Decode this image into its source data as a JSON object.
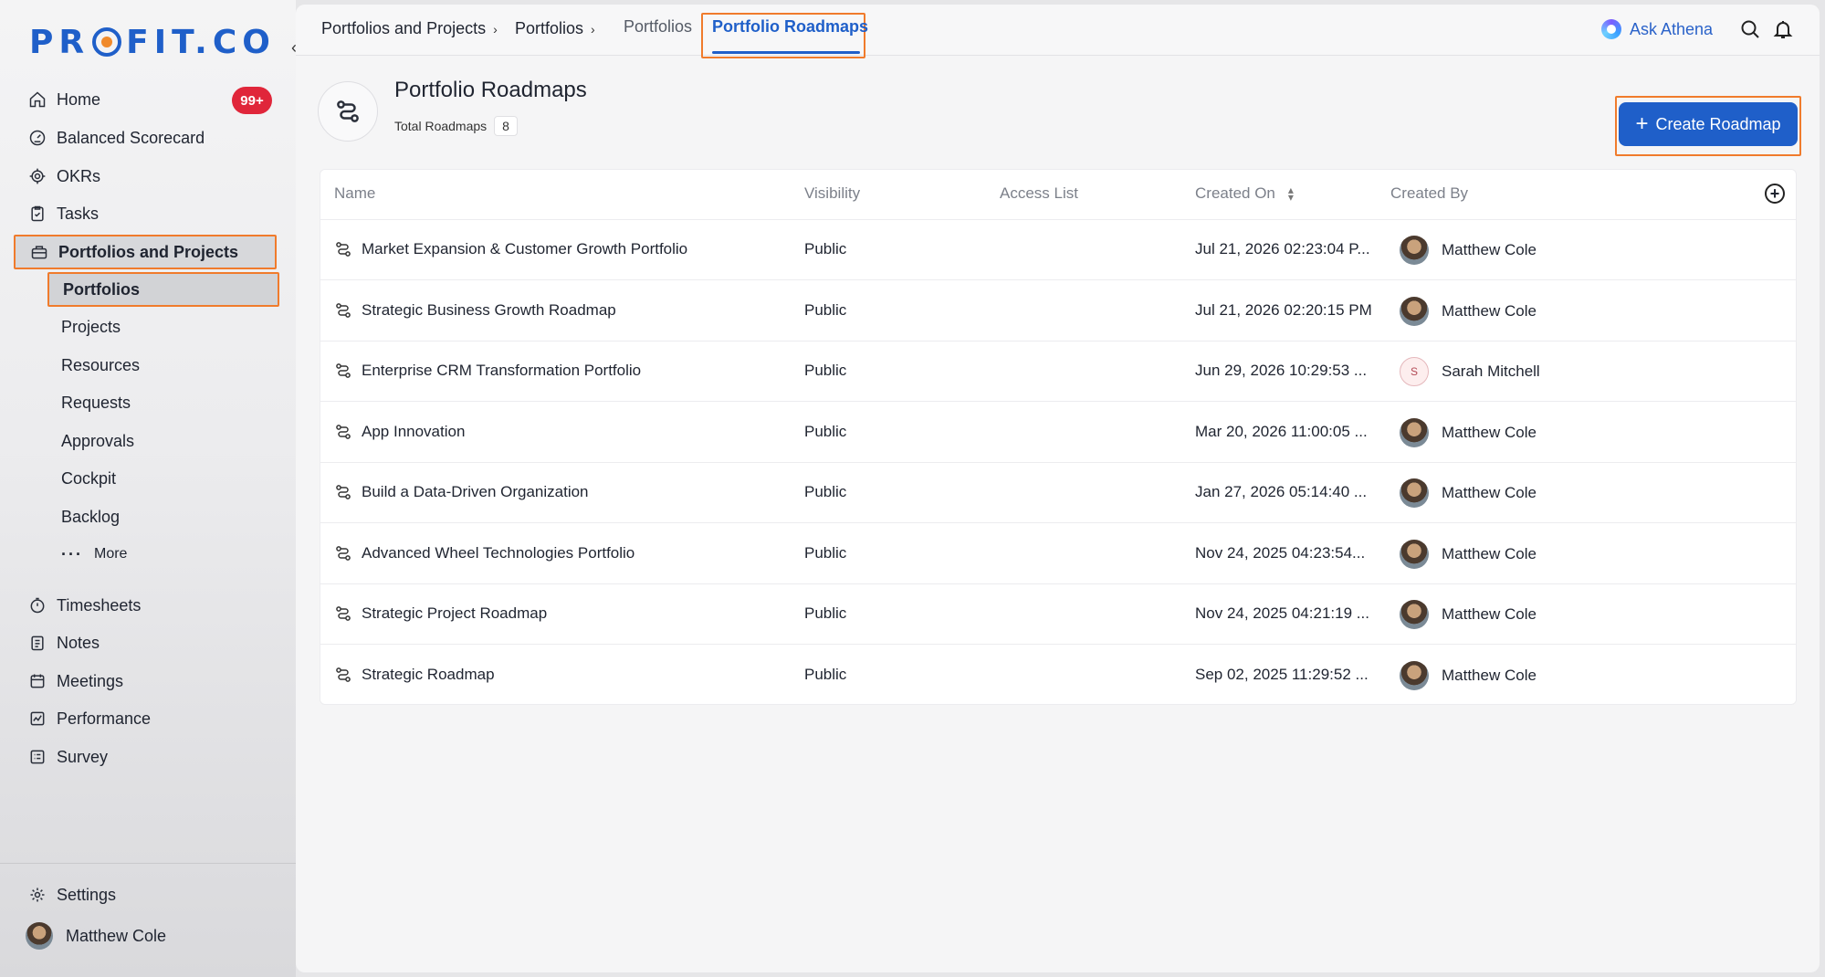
{
  "app": {
    "logo": "PROFIT.CO"
  },
  "sidebar": {
    "home": {
      "label": "Home",
      "badge": "99+"
    },
    "items": [
      {
        "label": "Balanced Scorecard"
      },
      {
        "label": "OKRs"
      },
      {
        "label": "Tasks"
      },
      {
        "label": "Portfolios and Projects"
      }
    ],
    "sub_items": [
      {
        "label": "Portfolios"
      },
      {
        "label": "Projects"
      },
      {
        "label": "Resources"
      },
      {
        "label": "Requests"
      },
      {
        "label": "Approvals"
      },
      {
        "label": "Cockpit"
      },
      {
        "label": "Backlog"
      }
    ],
    "more_label": "More",
    "lower_items": [
      {
        "label": "Timesheets"
      },
      {
        "label": "Notes"
      },
      {
        "label": "Meetings"
      },
      {
        "label": "Performance"
      },
      {
        "label": "Survey"
      }
    ],
    "settings_label": "Settings",
    "user_name": "Matthew Cole"
  },
  "topbar": {
    "breadcrumb": [
      "Portfolios and Projects",
      "Portfolios"
    ],
    "tabs": [
      "Portfolios",
      "Portfolio Roadmaps"
    ],
    "ask_athena": "Ask Athena"
  },
  "page": {
    "title": "Portfolio Roadmaps",
    "total_label": "Total Roadmaps",
    "total_count": "8",
    "create_button": "Create Roadmap"
  },
  "table": {
    "columns": [
      "Name",
      "Visibility",
      "Access List",
      "Created On",
      "Created By"
    ],
    "rows": [
      {
        "name": "Market Expansion & Customer Growth Portfolio",
        "visibility": "Public",
        "access": "",
        "created_on": "Jul 21, 2026 02:23:04 P...",
        "created_by": "Matthew Cole",
        "avatar": "photo"
      },
      {
        "name": "Strategic Business Growth Roadmap",
        "visibility": "Public",
        "access": "",
        "created_on": "Jul 21, 2026 02:20:15 PM",
        "created_by": "Matthew Cole",
        "avatar": "photo"
      },
      {
        "name": "Enterprise CRM Transformation Portfolio",
        "visibility": "Public",
        "access": "",
        "created_on": "Jun 29, 2026 10:29:53 ...",
        "created_by": "Sarah Mitchell",
        "avatar": "S"
      },
      {
        "name": "App Innovation",
        "visibility": "Public",
        "access": "",
        "created_on": "Mar 20, 2026 11:00:05 ...",
        "created_by": "Matthew Cole",
        "avatar": "photo"
      },
      {
        "name": "Build a Data-Driven Organization",
        "visibility": "Public",
        "access": "",
        "created_on": "Jan 27, 2026 05:14:40 ...",
        "created_by": "Matthew Cole",
        "avatar": "photo"
      },
      {
        "name": "Advanced Wheel Technologies Portfolio",
        "visibility": "Public",
        "access": "",
        "created_on": "Nov 24, 2025 04:23:54...",
        "created_by": "Matthew Cole",
        "avatar": "photo"
      },
      {
        "name": "Strategic Project Roadmap",
        "visibility": "Public",
        "access": "",
        "created_on": "Nov 24, 2025 04:21:19 ...",
        "created_by": "Matthew Cole",
        "avatar": "photo"
      },
      {
        "name": "Strategic Roadmap",
        "visibility": "Public",
        "access": "",
        "created_on": "Sep 02, 2025 11:29:52 ...",
        "created_by": "Matthew Cole",
        "avatar": "photo"
      }
    ]
  },
  "colors": {
    "accent": "#1f5fc9",
    "highlight": "#f07b2c",
    "badge": "#e0263a"
  }
}
